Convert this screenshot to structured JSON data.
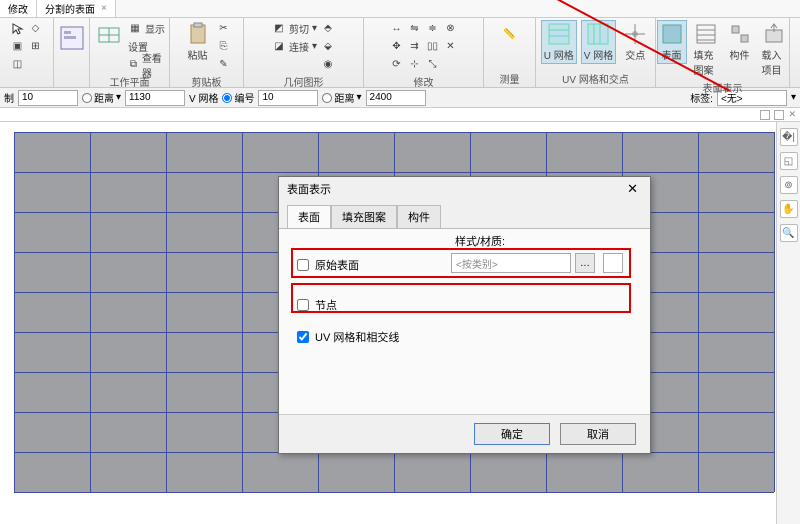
{
  "title_tabs": {
    "t1": "修改",
    "t2": "分割的表面",
    "close": "×"
  },
  "ribbon": {
    "work_plane": {
      "lbl": "工作平面",
      "show": "显示",
      "set": "设置",
      "viewer": "查看器"
    },
    "clipboard": {
      "lbl": "剪贴板",
      "paste": "粘贴"
    },
    "geometry": {
      "lbl": "几何图形",
      "cut": "剪切",
      "join": "连接"
    },
    "modify": {
      "lbl": "修改"
    },
    "measure": {
      "lbl": "测量"
    },
    "uv_grid": {
      "lbl": "UV 网格和交点",
      "u": "U 网格",
      "v": "V 网格",
      "intersect": "交点"
    },
    "surface": {
      "lbl": "表面表示",
      "face": "表面",
      "fill": "填充图案",
      "component": "构件",
      "more": "载入项目"
    }
  },
  "options": {
    "zhi": "制",
    "v1": "10",
    "distance1": "距离",
    "d1v": "1130",
    "vgrid": "V 网格",
    "numbered": "编号",
    "v2": "10",
    "distance2": "距离",
    "d2v": "2400",
    "label": "标签:",
    "labelv": "<无>"
  },
  "dialog": {
    "title": "表面表示",
    "tabs": {
      "surface": "表面",
      "fill": "填充图案",
      "component": "构件"
    },
    "style_label": "样式/材质:",
    "orig_surface": "原始表面",
    "material_ph": "<按类别>",
    "nodes": "节点",
    "uv_lines": "UV 网格和相交线",
    "ok": "确定",
    "cancel": "取消"
  }
}
